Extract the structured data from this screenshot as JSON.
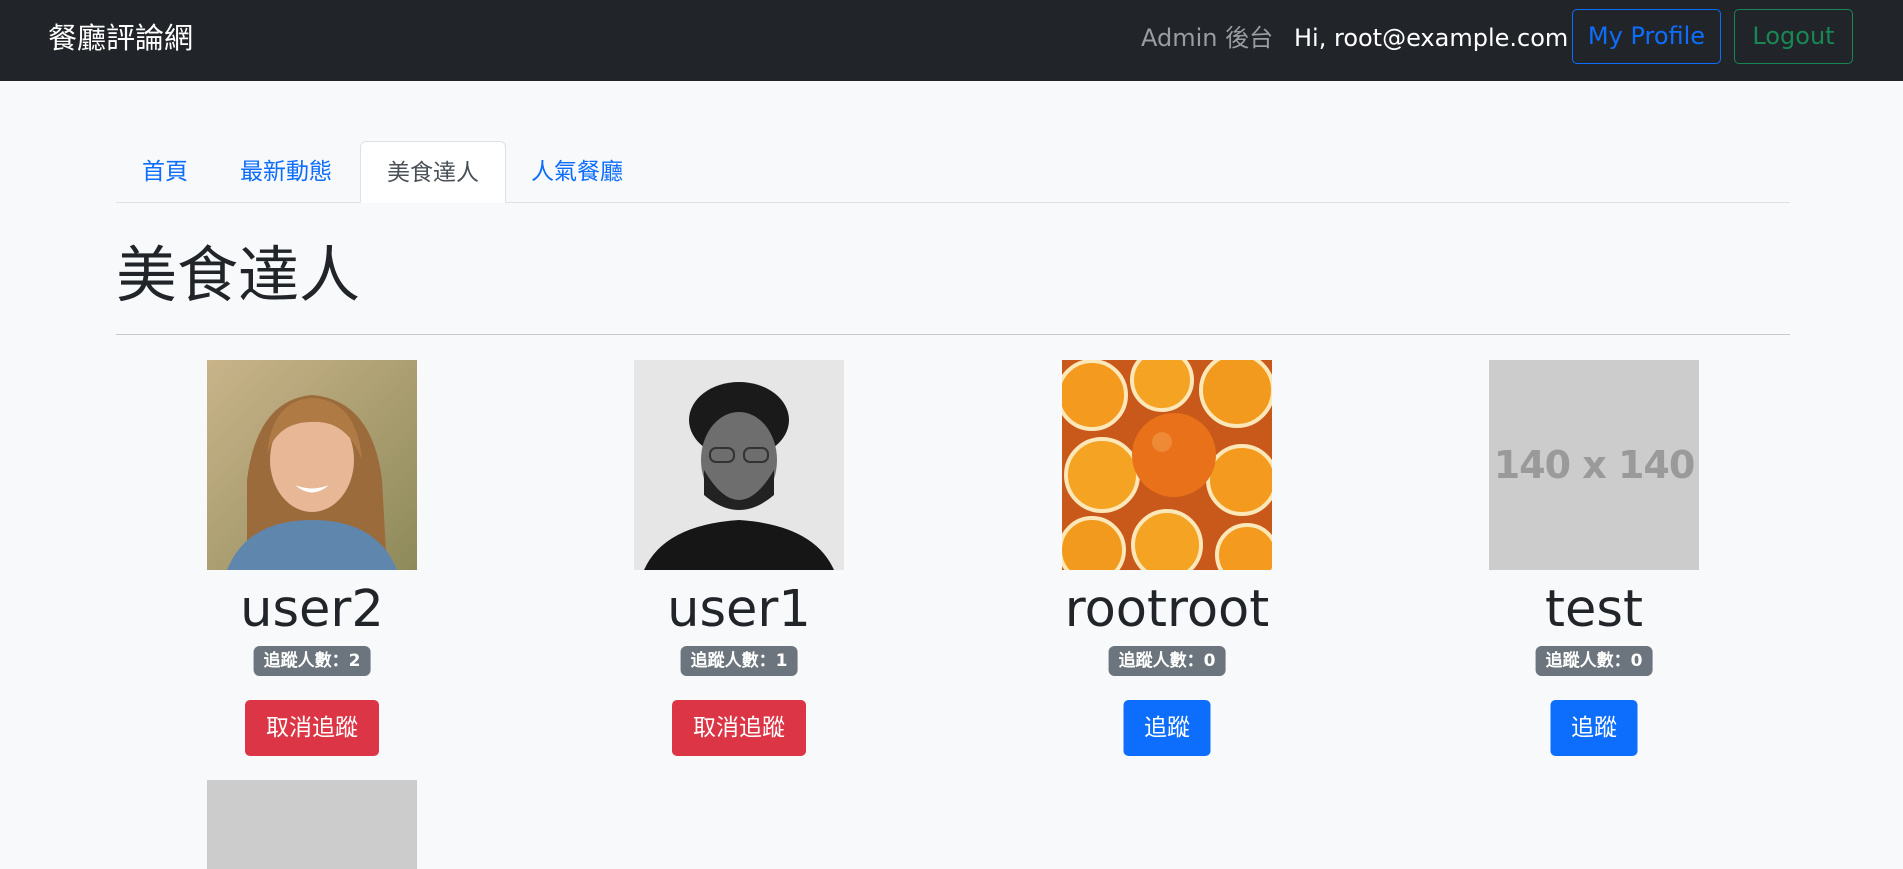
{
  "navbar": {
    "brand": "餐廳評論網",
    "admin_link": "Admin 後台",
    "greeting": "Hi, root@example.com",
    "profile_button": "My Profile",
    "logout_button": "Logout"
  },
  "tabs": [
    {
      "label": "首頁",
      "active": false
    },
    {
      "label": "最新動態",
      "active": false
    },
    {
      "label": "美食達人",
      "active": true
    },
    {
      "label": "人氣餐廳",
      "active": false
    }
  ],
  "page_title": "美食達人",
  "users": [
    {
      "name": "user2",
      "followers": "追蹤人數：2",
      "button": "取消追蹤",
      "following": true,
      "avatar": "woman-photo"
    },
    {
      "name": "user1",
      "followers": "追蹤人數：1",
      "button": "取消追蹤",
      "following": true,
      "avatar": "man-photo"
    },
    {
      "name": "rootroot",
      "followers": "追蹤人數：0",
      "button": "追蹤",
      "following": false,
      "avatar": "oranges-photo"
    },
    {
      "name": "test",
      "followers": "追蹤人數：0",
      "button": "追蹤",
      "following": false,
      "avatar": "placeholder",
      "placeholder_text": "140 x 140"
    }
  ],
  "colors": {
    "navbar_bg": "#212529",
    "primary": "#0d6efd",
    "success": "#198754",
    "danger": "#dc3545",
    "badge_bg": "#6c757d",
    "placeholder_bg": "#cccccc"
  }
}
